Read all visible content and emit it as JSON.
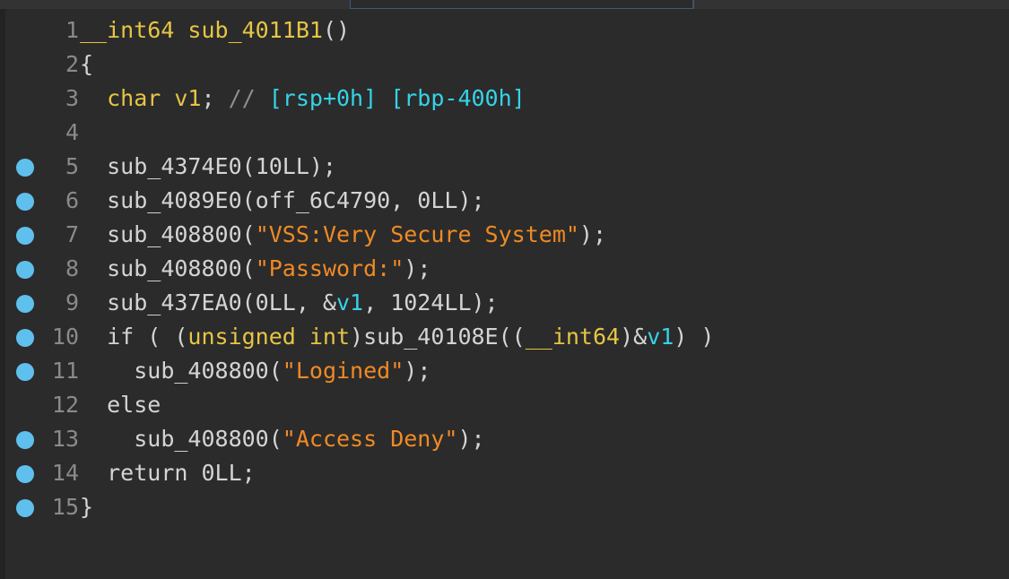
{
  "editor": {
    "lines": [
      {
        "n": "1",
        "bp": false,
        "indent": "",
        "tokens": [
          {
            "t": "__int64 sub_4011B1",
            "c": "fn"
          },
          {
            "t": "()",
            "c": "plain"
          }
        ]
      },
      {
        "n": "2",
        "bp": false,
        "indent": "",
        "tokens": [
          {
            "t": "{",
            "c": "plain"
          }
        ]
      },
      {
        "n": "3",
        "bp": false,
        "indent": "  ",
        "tokens": [
          {
            "t": "char v1",
            "c": "kw"
          },
          {
            "t": "; ",
            "c": "plain"
          },
          {
            "t": "// ",
            "c": "cmt"
          },
          {
            "t": "[rsp+0h] [rbp-400h]",
            "c": "reg"
          }
        ]
      },
      {
        "n": "4",
        "bp": false,
        "indent": "",
        "tokens": []
      },
      {
        "n": "5",
        "bp": true,
        "indent": "  ",
        "tokens": [
          {
            "t": "sub_4374E0(10LL);",
            "c": "plain"
          }
        ]
      },
      {
        "n": "6",
        "bp": true,
        "indent": "  ",
        "tokens": [
          {
            "t": "sub_4089E0(off_6C4790, 0LL);",
            "c": "plain"
          }
        ]
      },
      {
        "n": "7",
        "bp": true,
        "indent": "  ",
        "tokens": [
          {
            "t": "sub_408800(",
            "c": "plain"
          },
          {
            "t": "\"VSS:Very Secure System\"",
            "c": "str"
          },
          {
            "t": ");",
            "c": "plain"
          }
        ]
      },
      {
        "n": "8",
        "bp": true,
        "indent": "  ",
        "tokens": [
          {
            "t": "sub_408800(",
            "c": "plain"
          },
          {
            "t": "\"Password:\"",
            "c": "str"
          },
          {
            "t": ");",
            "c": "plain"
          }
        ]
      },
      {
        "n": "9",
        "bp": true,
        "indent": "  ",
        "tokens": [
          {
            "t": "sub_437EA0(0LL, &",
            "c": "plain"
          },
          {
            "t": "v1",
            "c": "var"
          },
          {
            "t": ", 1024LL);",
            "c": "plain"
          }
        ]
      },
      {
        "n": "10",
        "bp": true,
        "indent": "  ",
        "tokens": [
          {
            "t": "if ( (",
            "c": "plain"
          },
          {
            "t": "unsigned int",
            "c": "kw"
          },
          {
            "t": ")sub_40108E((",
            "c": "plain"
          },
          {
            "t": "__int64",
            "c": "kw"
          },
          {
            "t": ")&",
            "c": "plain"
          },
          {
            "t": "v1",
            "c": "var"
          },
          {
            "t": ") )",
            "c": "plain"
          }
        ]
      },
      {
        "n": "11",
        "bp": true,
        "indent": "    ",
        "tokens": [
          {
            "t": "sub_408800(",
            "c": "plain"
          },
          {
            "t": "\"Logined\"",
            "c": "str"
          },
          {
            "t": ");",
            "c": "plain"
          }
        ]
      },
      {
        "n": "12",
        "bp": false,
        "indent": "  ",
        "tokens": [
          {
            "t": "else",
            "c": "plain"
          }
        ]
      },
      {
        "n": "13",
        "bp": true,
        "indent": "    ",
        "tokens": [
          {
            "t": "sub_408800(",
            "c": "plain"
          },
          {
            "t": "\"Access Deny\"",
            "c": "str"
          },
          {
            "t": ");",
            "c": "plain"
          }
        ]
      },
      {
        "n": "14",
        "bp": true,
        "indent": "  ",
        "tokens": [
          {
            "t": "return 0LL;",
            "c": "plain"
          }
        ]
      },
      {
        "n": "15",
        "bp": true,
        "indent": "",
        "tokens": [
          {
            "t": "}",
            "c": "plain"
          }
        ]
      }
    ]
  },
  "colors": {
    "background": "#2b2b2b",
    "keyword": "#e6c545",
    "string": "#f08a24",
    "register_comment": "#35d3e8",
    "breakpoint": "#5fc0ee",
    "line_number": "#8a8a8a"
  }
}
